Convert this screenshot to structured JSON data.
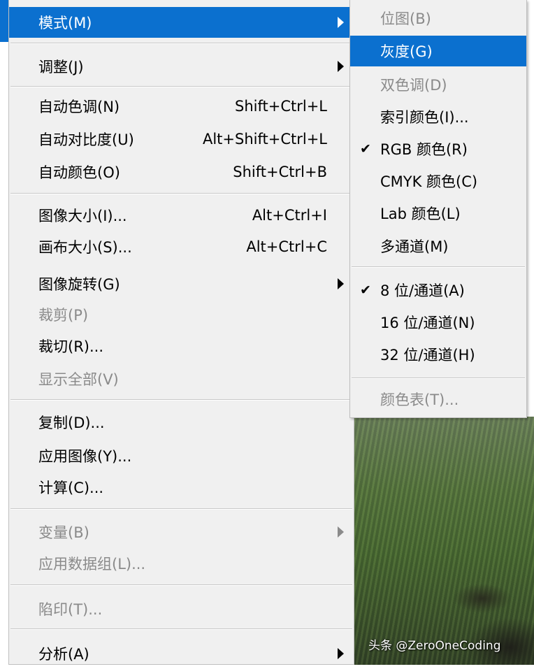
{
  "main_menu": {
    "items": [
      {
        "label": "模式(M)",
        "shortcut": ""
      },
      {
        "label": "调整(J)",
        "shortcut": ""
      },
      {
        "label": "自动色调(N)",
        "shortcut": "Shift+Ctrl+L"
      },
      {
        "label": "自动对比度(U)",
        "shortcut": "Alt+Shift+Ctrl+L"
      },
      {
        "label": "自动颜色(O)",
        "shortcut": "Shift+Ctrl+B"
      },
      {
        "label": "图像大小(I)...",
        "shortcut": "Alt+Ctrl+I"
      },
      {
        "label": "画布大小(S)...",
        "shortcut": "Alt+Ctrl+C"
      },
      {
        "label": "图像旋转(G)",
        "shortcut": ""
      },
      {
        "label": "裁剪(P)",
        "shortcut": ""
      },
      {
        "label": "裁切(R)...",
        "shortcut": ""
      },
      {
        "label": "显示全部(V)",
        "shortcut": ""
      },
      {
        "label": "复制(D)...",
        "shortcut": ""
      },
      {
        "label": "应用图像(Y)...",
        "shortcut": ""
      },
      {
        "label": "计算(C)...",
        "shortcut": ""
      },
      {
        "label": "变量(B)",
        "shortcut": ""
      },
      {
        "label": "应用数据组(L)...",
        "shortcut": ""
      },
      {
        "label": "陷印(T)...",
        "shortcut": ""
      },
      {
        "label": "分析(A)",
        "shortcut": ""
      }
    ]
  },
  "mode_submenu": {
    "items": [
      {
        "label": "位图(B)"
      },
      {
        "label": "灰度(G)"
      },
      {
        "label": "双色调(D)"
      },
      {
        "label": "索引颜色(I)..."
      },
      {
        "label": "RGB 颜色(R)"
      },
      {
        "label": "CMYK 颜色(C)"
      },
      {
        "label": "Lab 颜色(L)"
      },
      {
        "label": "多通道(M)"
      },
      {
        "label": "8 位/通道(A)"
      },
      {
        "label": "16 位/通道(N)"
      },
      {
        "label": "32 位/通道(H)"
      },
      {
        "label": "颜色表(T)..."
      }
    ],
    "checkmark": "✔"
  },
  "watermark": "头条 @ZeroOneCoding",
  "colors": {
    "highlight": "#0b70cf",
    "menu_bg": "#f0f0f0",
    "disabled_text": "#8a8a8a"
  }
}
